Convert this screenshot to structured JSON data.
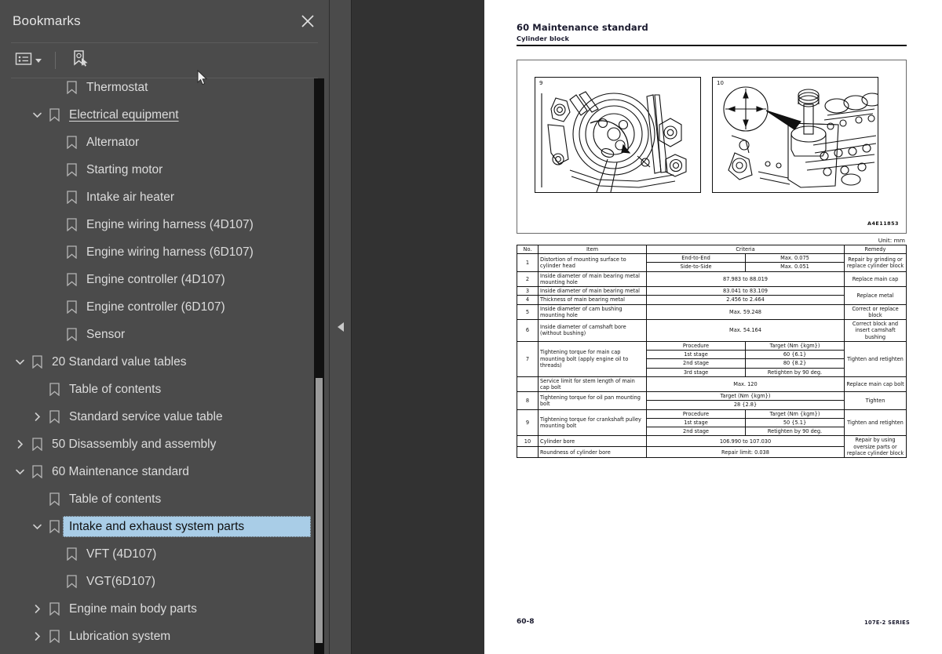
{
  "panel": {
    "title": "Bookmarks",
    "close_icon": "close-icon",
    "toolbar": {
      "options_icon": "list-options-icon",
      "options_caret": "chevron-down-icon",
      "new_bookmark_icon": "new-bookmark-icon"
    }
  },
  "tree": [
    {
      "label": "Thermostat",
      "depth": 2,
      "twisty": "none",
      "selected": false,
      "underlined": false
    },
    {
      "label": "Electrical equipment ",
      "depth": 1,
      "twisty": "expanded",
      "selected": false,
      "underlined": true
    },
    {
      "label": "Alternator",
      "depth": 2,
      "twisty": "none",
      "selected": false,
      "underlined": false
    },
    {
      "label": "Starting motor",
      "depth": 2,
      "twisty": "none",
      "selected": false,
      "underlined": false
    },
    {
      "label": "Intake air heater",
      "depth": 2,
      "twisty": "none",
      "selected": false,
      "underlined": false
    },
    {
      "label": "Engine wiring harness (4D107)",
      "depth": 2,
      "twisty": "none",
      "selected": false,
      "underlined": false
    },
    {
      "label": "Engine wiring harness (6D107)",
      "depth": 2,
      "twisty": "none",
      "selected": false,
      "underlined": false
    },
    {
      "label": "Engine controller (4D107)",
      "depth": 2,
      "twisty": "none",
      "selected": false,
      "underlined": false
    },
    {
      "label": "Engine controller (6D107)",
      "depth": 2,
      "twisty": "none",
      "selected": false,
      "underlined": false
    },
    {
      "label": "Sensor",
      "depth": 2,
      "twisty": "none",
      "selected": false,
      "underlined": false
    },
    {
      "label": "20 Standard value tables",
      "depth": 0,
      "twisty": "expanded",
      "selected": false,
      "underlined": false
    },
    {
      "label": "Table of contents",
      "depth": 1,
      "twisty": "none",
      "selected": false,
      "underlined": false
    },
    {
      "label": "Standard service value table",
      "depth": 1,
      "twisty": "collapsed",
      "selected": false,
      "underlined": false
    },
    {
      "label": "50 Disassembly and assembly",
      "depth": 0,
      "twisty": "collapsed",
      "selected": false,
      "underlined": false
    },
    {
      "label": "60 Maintenance standard",
      "depth": 0,
      "twisty": "expanded",
      "selected": false,
      "underlined": false
    },
    {
      "label": "Table of contents",
      "depth": 1,
      "twisty": "none",
      "selected": false,
      "underlined": false
    },
    {
      "label": "Intake and exhaust system parts",
      "depth": 1,
      "twisty": "expanded",
      "selected": true,
      "underlined": false
    },
    {
      "label": "VFT (4D107)",
      "depth": 2,
      "twisty": "none",
      "selected": false,
      "underlined": false
    },
    {
      "label": "VGT(6D107)",
      "depth": 2,
      "twisty": "none",
      "selected": false,
      "underlined": false
    },
    {
      "label": "Engine main body parts",
      "depth": 1,
      "twisty": "collapsed",
      "selected": false,
      "underlined": false
    },
    {
      "label": "Lubrication system",
      "depth": 1,
      "twisty": "collapsed",
      "selected": false,
      "underlined": false
    }
  ],
  "splitter": {
    "collapse_icon": "collapse-left-arrow-icon"
  },
  "document": {
    "heading": "60 Maintenance standard",
    "subheading": "Cylinder block",
    "figure": {
      "left_number": "9",
      "right_number": "10",
      "code": "A4E11853"
    },
    "unit_note": "Unit: mm",
    "table": {
      "headers": {
        "no": "No.",
        "item": "Item",
        "criteria": "Criteria",
        "remedy": "Remedy"
      },
      "rows": [
        {
          "no": "1",
          "item": "Distortion of mounting surface to cylinder head",
          "criteria_pairs": [
            {
              "left": "End-to-End",
              "right": "Max. 0.075"
            },
            {
              "left": "Side-to-Side",
              "right": "Max. 0.051"
            }
          ],
          "remedy": "Repair by grinding or replace cylinder block"
        },
        {
          "no": "2",
          "item": "Inside diameter of main bearing metal mounting hole",
          "criteria": "87.983 to 88.019",
          "remedy": "Replace main cap"
        },
        {
          "no": "3",
          "item": "Inside diameter of main bearing metal",
          "criteria": "83.041 to 83.109",
          "remedy": "Replace metal"
        },
        {
          "no": "4",
          "item": "Thickness of main bearing metal",
          "criteria": "2.456 to 2.464",
          "remedy": ""
        },
        {
          "no": "5",
          "item": "Inside diameter of cam bushing mounting hole",
          "criteria": "Max. 59.248",
          "remedy": "Correct or replace block"
        },
        {
          "no": "6",
          "item": "Inside diameter of camshaft bore (without bushing)",
          "criteria": "Max. 54.164",
          "remedy": "Correct block and insert camshaft bushing"
        },
        {
          "no": "7",
          "item": "Tightening torque for main cap mounting bolt (apply engine oil to threads)",
          "criteria_pairs": [
            {
              "left": "Procedure",
              "right": "Target (Nm {kgm})"
            },
            {
              "left": "1st stage",
              "right": "60 {6.1}"
            },
            {
              "left": "2nd stage",
              "right": "80 {8.2}"
            },
            {
              "left": "3rd stage",
              "right": "Retighten by 90 deg."
            }
          ],
          "remedy": "Tighten and retighten"
        },
        {
          "no": "",
          "item": "Service limit for stem length of main cap bolt",
          "criteria": "Max. 120",
          "remedy": "Replace main cap bolt"
        },
        {
          "no": "8",
          "item": "Tightening torque for oil pan mounting bolt",
          "criteria_stack": [
            "Target (Nm {kgm})",
            "28 {2.8}"
          ],
          "remedy": "Tighten"
        },
        {
          "no": "9",
          "item": "Tightening torque for crankshaft pulley mounting bolt",
          "criteria_pairs": [
            {
              "left": "Procedure",
              "right": "Target (Nm {kgm})"
            },
            {
              "left": "1st stage",
              "right": "50 {5.1}"
            },
            {
              "left": "2nd stage",
              "right": "Retighten by 90 deg."
            }
          ],
          "remedy": "Tighten and retighten"
        },
        {
          "no": "10",
          "item": "Cylinder bore",
          "criteria": "106.990 to 107.030",
          "remedy": "Repair by using oversize parts or replace cylinder block"
        },
        {
          "no": "",
          "item": "Roundness of cylinder bore",
          "criteria": "Repair limit: 0.038",
          "remedy": ""
        }
      ]
    },
    "footer": {
      "page": "60-8",
      "series": "107E-2 SERIES"
    }
  },
  "colors": {
    "panel_bg": "#4b4b4b",
    "viewer_bg": "#323232",
    "selection": "#a9cde7",
    "text": "#dcdcdc"
  }
}
